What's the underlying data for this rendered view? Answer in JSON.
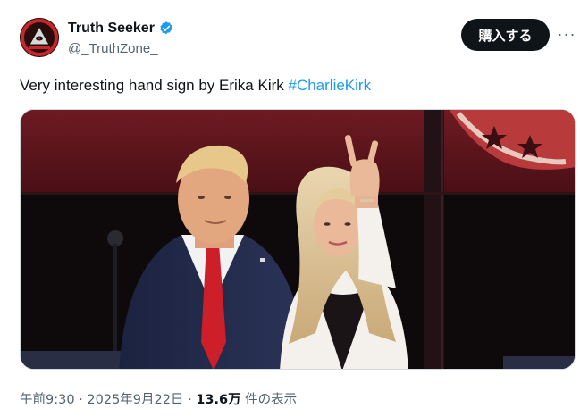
{
  "author": {
    "display_name": "Truth Seeker",
    "handle": "@_TruthZone_",
    "verified": true,
    "verified_color": "#1d9bf0"
  },
  "header": {
    "buy_label": "購入する",
    "more_icon": "more-horizontal-icon",
    "more_label": "···"
  },
  "tweet": {
    "text": "Very interesting hand sign by Erika Kirk ",
    "hashtag": "#CharlieKirk",
    "hashtag_color": "#1d9bf0"
  },
  "media": {
    "type": "image"
  },
  "meta": {
    "time": "午前9:30",
    "separator": " · ",
    "date": "2025年9月22日",
    "separator2": " · ",
    "views": "13.6万",
    "views_label": " 件の表示"
  }
}
